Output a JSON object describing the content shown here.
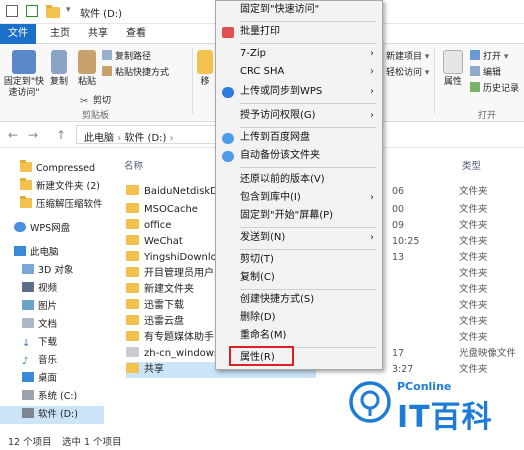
{
  "window": {
    "title": "软件 (D:)"
  },
  "ribbon_tabs": [
    "文件",
    "主页",
    "共享",
    "查看"
  ],
  "ribbon": {
    "pin_label": "固定到\"快速访问\"",
    "copy": "复制",
    "paste": "粘贴",
    "copy_path": "复制路径",
    "paste_shortcut": "粘贴快捷方式",
    "cut": "剪切",
    "clipboard_group": "剪贴板",
    "move_to": "移",
    "new_item": "新建项目",
    "easy_access": "轻松访问",
    "properties": "属性",
    "open": "打开",
    "edit": "编辑",
    "history": "历史记录",
    "open_group": "打开"
  },
  "address": {
    "back": "←",
    "forward": "→",
    "up": "↑",
    "path": [
      "此电脑",
      "软件 (D:)"
    ]
  },
  "navpane": [
    {
      "label": "Compressed",
      "icon": "folder-icon"
    },
    {
      "label": "新建文件夹 (2)",
      "icon": "folder-icon"
    },
    {
      "label": "压缩解压缩软件",
      "icon": "folder-icon"
    },
    {
      "label": "WPS网盘",
      "icon": "cloud-icon"
    },
    {
      "label": "此电脑",
      "icon": "computer-icon"
    },
    {
      "label": "3D 对象",
      "icon": "cube-icon"
    },
    {
      "label": "视频",
      "icon": "video-icon"
    },
    {
      "label": "图片",
      "icon": "picture-icon"
    },
    {
      "label": "文档",
      "icon": "document-icon"
    },
    {
      "label": "下载",
      "icon": "download-icon"
    },
    {
      "label": "音乐",
      "icon": "music-icon"
    },
    {
      "label": "桌面",
      "icon": "desktop-icon"
    },
    {
      "label": "系统 (C:)",
      "icon": "drive-icon"
    },
    {
      "label": "软件 (D:)",
      "icon": "drive-icon"
    }
  ],
  "filelist": {
    "col_name": "名称",
    "col_type": "类型",
    "rows": [
      {
        "name": "BaiduNetdiskDo",
        "date": "06",
        "type": "文件夹"
      },
      {
        "name": "MSOCache",
        "date": "00",
        "type": "文件夹"
      },
      {
        "name": "office",
        "date": "09",
        "type": "文件夹"
      },
      {
        "name": "WeChat",
        "date": "10:25",
        "type": "文件夹"
      },
      {
        "name": "YingshiDownloa",
        "date": "13",
        "type": "文件夹"
      },
      {
        "name": "开目管理员用户",
        "date": "",
        "type": "文件夹"
      },
      {
        "name": "新建文件夹",
        "date": "",
        "type": "文件夹"
      },
      {
        "name": "迅雷下载",
        "date": "",
        "type": "文件夹"
      },
      {
        "name": "迅雷云盘",
        "date": "",
        "type": "文件夹"
      },
      {
        "name": "有专题媒体助手",
        "date": "",
        "type": "文件夹"
      },
      {
        "name": "zh-cn_windows_",
        "date": "17",
        "type": "光盘映像文件"
      },
      {
        "name": "共享",
        "date": "3:27",
        "type": "文件夹"
      }
    ]
  },
  "context_menu": {
    "items": [
      {
        "label": "固定到\"快速访问\"",
        "arrow": false,
        "icon": ""
      },
      {
        "label": "批量打印",
        "arrow": false,
        "icon": "print-icon"
      },
      {
        "label": "7-Zip",
        "arrow": true,
        "icon": ""
      },
      {
        "label": "CRC SHA",
        "arrow": true,
        "icon": ""
      },
      {
        "label": "上传或同步到WPS",
        "arrow": true,
        "icon": "wps-cloud-icon"
      },
      {
        "label": "授予访问权限(G)",
        "arrow": true,
        "icon": ""
      },
      {
        "label": "上传到百度网盘",
        "arrow": false,
        "icon": "baidu-cloud-icon"
      },
      {
        "label": "自动备份该文件夹",
        "arrow": false,
        "icon": "baidu-cloud-icon"
      },
      {
        "label": "还原以前的版本(V)",
        "arrow": false,
        "icon": ""
      },
      {
        "label": "包含到库中(I)",
        "arrow": true,
        "icon": ""
      },
      {
        "label": "固定到\"开始\"屏幕(P)",
        "arrow": false,
        "icon": ""
      },
      {
        "label": "发送到(N)",
        "arrow": true,
        "icon": ""
      },
      {
        "label": "剪切(T)",
        "arrow": false,
        "icon": ""
      },
      {
        "label": "复制(C)",
        "arrow": false,
        "icon": ""
      },
      {
        "label": "创建快捷方式(S)",
        "arrow": false,
        "icon": ""
      },
      {
        "label": "删除(D)",
        "arrow": false,
        "icon": ""
      },
      {
        "label": "重命名(M)",
        "arrow": false,
        "icon": ""
      },
      {
        "label": "属性(R)",
        "arrow": false,
        "icon": ""
      }
    ]
  },
  "status": {
    "count": "12 个项目",
    "selected": "选中 1 个项目"
  },
  "watermark": {
    "brand": "PConline",
    "name": "IT百科"
  },
  "colors": {
    "accent": "#1a6fc9",
    "folder": "#f2c14e",
    "highlight": "#e02020",
    "watermark": "#1e7bd6"
  }
}
